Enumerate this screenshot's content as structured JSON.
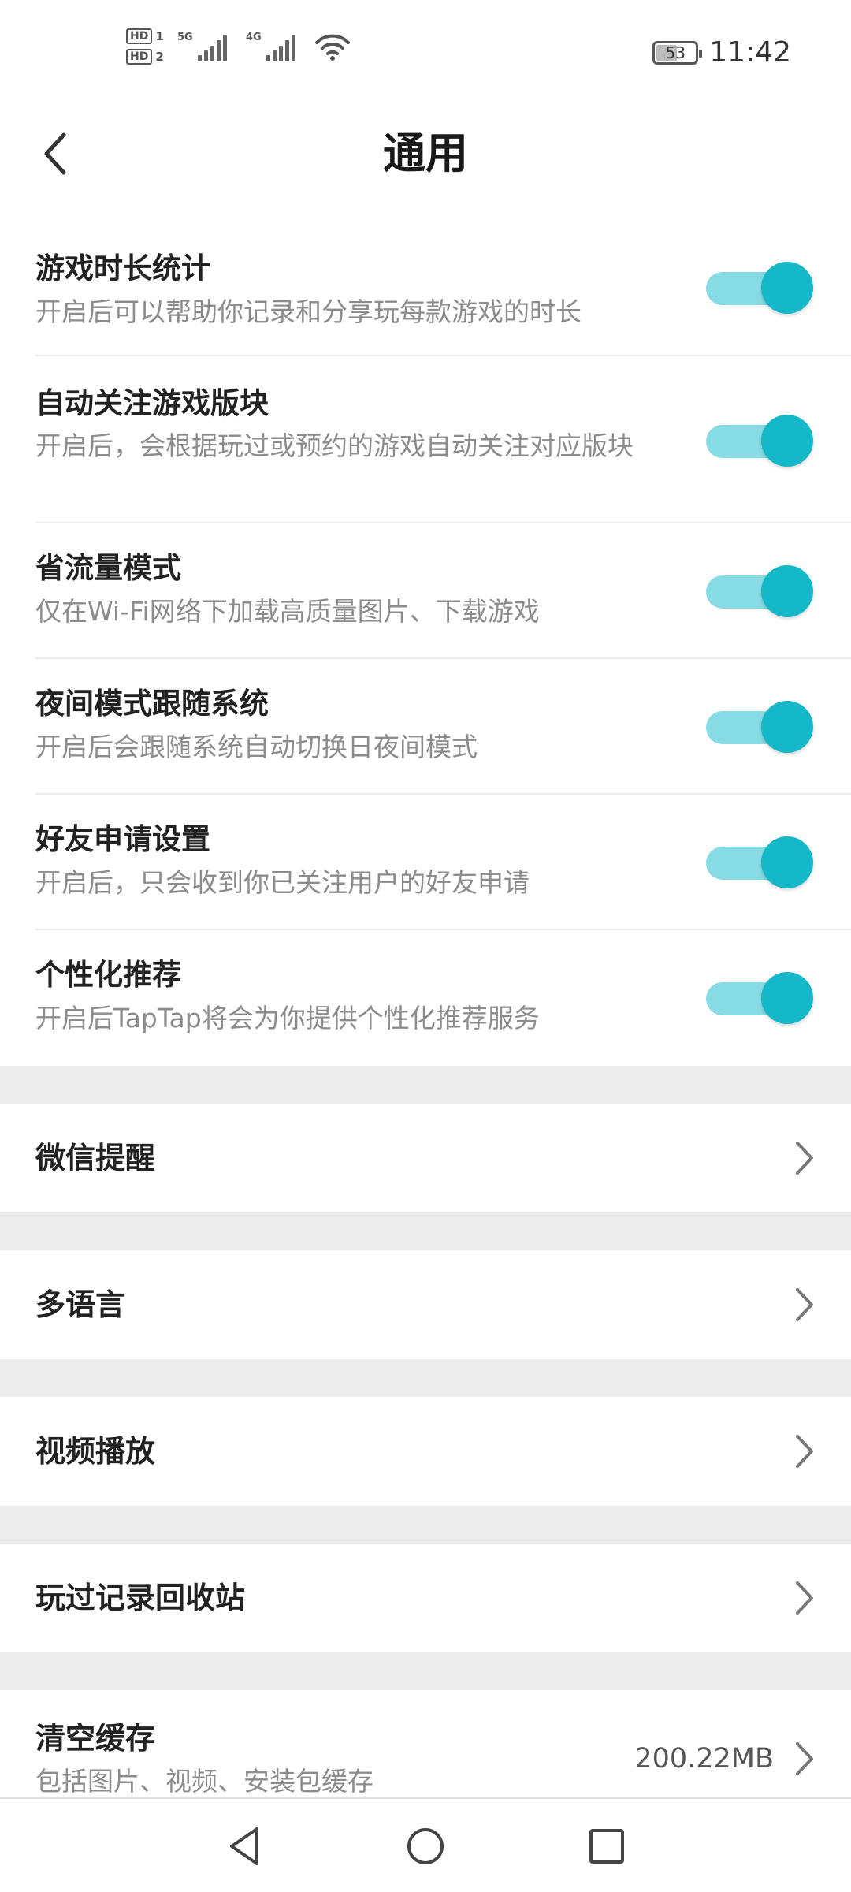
{
  "status_bar": {
    "sim1": "HD",
    "sim1_num": "1",
    "sim2": "HD",
    "sim2_num": "2",
    "net1": "5G",
    "net2": "4G",
    "battery": "53",
    "battery_level_percent": 53,
    "time": "11:42"
  },
  "header": {
    "title": "通用"
  },
  "toggles": [
    {
      "title": "游戏时长统计",
      "desc": "开启后可以帮助你记录和分享玩每款游戏的时长",
      "on": true
    },
    {
      "title": "自动关注游戏版块",
      "desc": "开启后，会根据玩过或预约的游戏自动关注对应版块",
      "on": true
    },
    {
      "title": "省流量模式",
      "desc": "仅在Wi-Fi网络下加载高质量图片、下载游戏",
      "on": true
    },
    {
      "title": "夜间模式跟随系统",
      "desc": "开启后会跟随系统自动切换日夜间模式",
      "on": true
    },
    {
      "title": "好友申请设置",
      "desc": "开启后，只会收到你已关注用户的好友申请",
      "on": true
    },
    {
      "title": "个性化推荐",
      "desc": "开启后TapTap将会为你提供个性化推荐服务",
      "on": true
    }
  ],
  "nav_items": [
    {
      "label": "微信提醒"
    },
    {
      "label": "多语言"
    },
    {
      "label": "视频播放"
    },
    {
      "label": "玩过记录回收站"
    }
  ],
  "cache": {
    "label": "清空缓存",
    "desc": "包括图片、视频、安装包缓存",
    "size": "200.22MB"
  },
  "colors": {
    "accent": "#15b8c8",
    "track": "#86dbe4",
    "separator": "#ececec"
  },
  "icons": {
    "back": "chevron-left-icon",
    "row_arrow": "chevron-right-icon",
    "nav_back": "triangle-back-icon",
    "nav_home": "circle-home-icon",
    "nav_recent": "square-recent-icon"
  }
}
